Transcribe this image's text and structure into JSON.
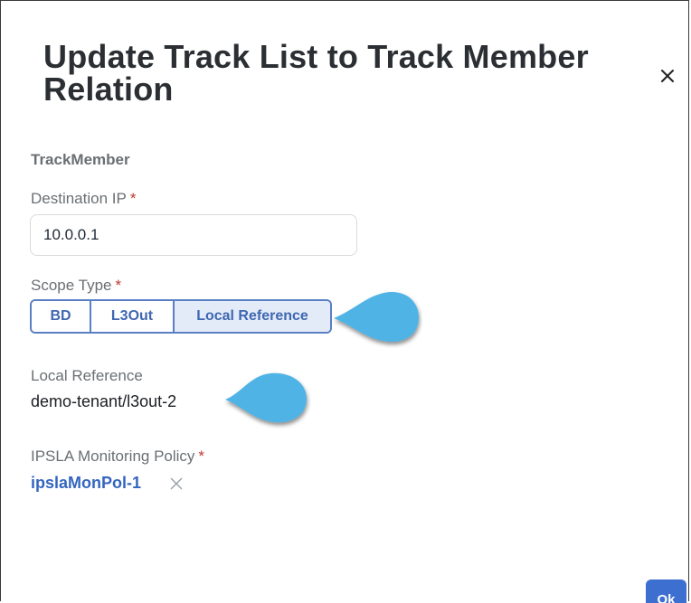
{
  "dialog": {
    "title": "Update Track List to Track Member Relation",
    "close_label": "×"
  },
  "section": {
    "title": "TrackMember"
  },
  "destination_ip": {
    "label": "Destination IP",
    "required_mark": "*",
    "value": "10.0.0.1"
  },
  "scope_type": {
    "label": "Scope Type",
    "required_mark": "*",
    "options": [
      "BD",
      "L3Out",
      "Local Reference"
    ],
    "selected": "Local Reference"
  },
  "local_reference": {
    "label": "Local Reference",
    "value": "demo-tenant/l3out-2"
  },
  "ipsla_policy": {
    "label": "IPSLA Monitoring Policy",
    "required_mark": "*",
    "value": "ipslaMonPol-1"
  },
  "footer": {
    "ok_label": "Ok"
  },
  "colors": {
    "accent": "#3d6fd1",
    "link": "#3465c0",
    "required": "#c0392b",
    "callout": "#4fb3e6"
  }
}
